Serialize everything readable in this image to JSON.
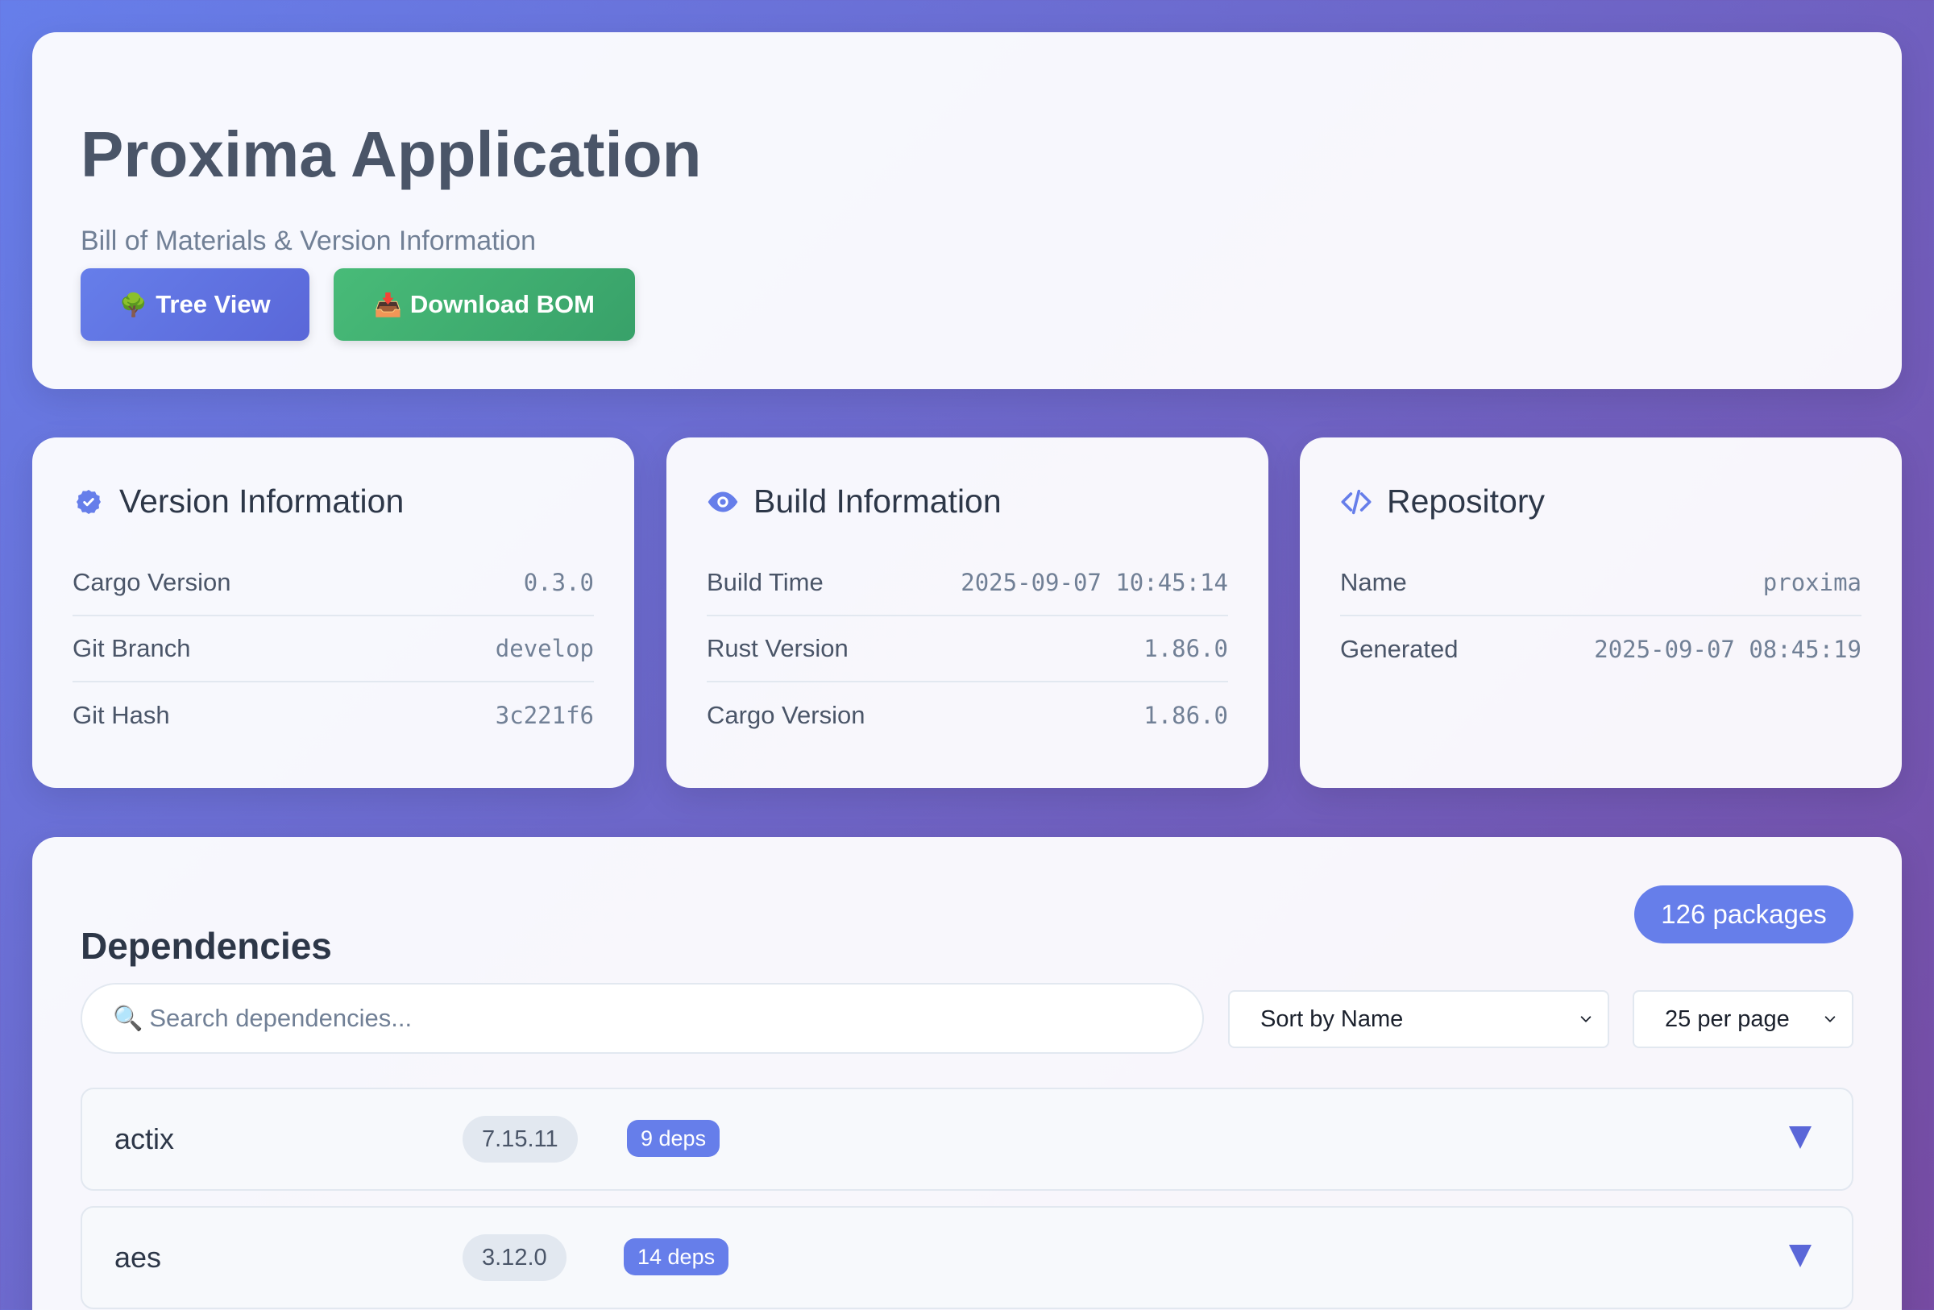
{
  "header": {
    "title": "Proxima Application",
    "subtitle": "Bill of Materials & Version Information",
    "tree_view_emoji": "🌳",
    "tree_view_label": "Tree View",
    "download_emoji": "📥",
    "download_label": "Download BOM"
  },
  "version_card": {
    "title": "Version Information",
    "icon": "badge-check-icon",
    "rows": [
      {
        "label": "Cargo Version",
        "value": "0.3.0"
      },
      {
        "label": "Git Branch",
        "value": "develop"
      },
      {
        "label": "Git Hash",
        "value": "3c221f6"
      }
    ]
  },
  "build_card": {
    "title": "Build Information",
    "icon": "eye-icon",
    "rows": [
      {
        "label": "Build Time",
        "value": "2025-09-07 10:45:14"
      },
      {
        "label": "Rust Version",
        "value": "1.86.0"
      },
      {
        "label": "Cargo Version",
        "value": "1.86.0"
      }
    ]
  },
  "repo_card": {
    "title": "Repository",
    "icon": "code-icon",
    "rows": [
      {
        "label": "Name",
        "value": "proxima"
      },
      {
        "label": "Generated",
        "value": "2025-09-07 08:45:19"
      }
    ]
  },
  "dependencies": {
    "title": "Dependencies",
    "count_badge": "126 packages",
    "search_placeholder": "Search dependencies...",
    "search_icon": "🔍",
    "sort_selected": "Sort by Name",
    "page_size_selected": "25 per page",
    "items": [
      {
        "name": "actix",
        "version": "7.15.11",
        "deps": "9 deps"
      },
      {
        "name": "aes",
        "version": "3.12.0",
        "deps": "14 deps"
      }
    ]
  },
  "colors": {
    "accent": "#667eea",
    "success": "#48bb78",
    "background_start": "#667eea",
    "background_end": "#764ba2"
  }
}
